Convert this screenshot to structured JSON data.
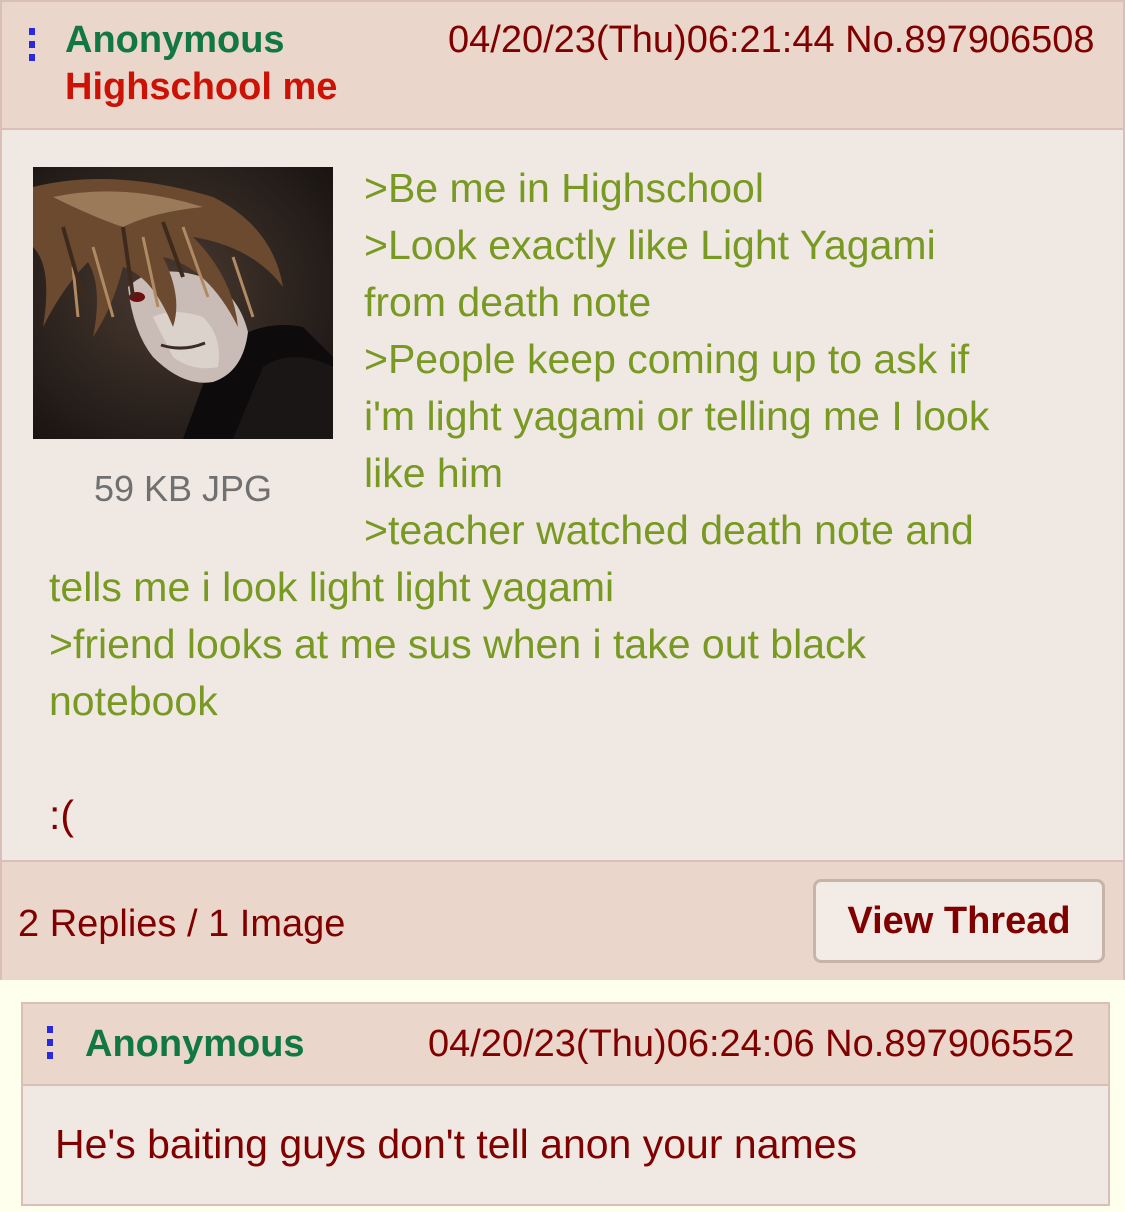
{
  "op": {
    "name": "Anonymous",
    "subject": "Highschool me",
    "datetime": "04/20/23(Thu)06:21:44 No.897906508",
    "file_info": "59 KB JPG",
    "comment": {
      "line1": ">Be me in Highschool",
      "line2": ">Look exactly like Light Yagami",
      "line3": "from death note",
      "line4": ">People keep coming up to ask if",
      "line5": "i'm light yagami or telling me I look",
      "line6": "like him",
      "line7": ">teacher watched death note and",
      "line8": "tells me i look light light yagami",
      "line9": ">friend looks at me sus when i take out black",
      "line10": "notebook",
      "line11": ":("
    },
    "replies_summary": "2 Replies / 1 Image",
    "view_thread_label": "View Thread"
  },
  "reply": {
    "name": "Anonymous",
    "datetime": "04/20/23(Thu)06:24:06 No.897906552",
    "comment": "He's baiting guys don't tell anon your names"
  },
  "colors": {
    "name": "#117743",
    "subject": "#cc1105",
    "greentext": "#789922",
    "text": "#800000",
    "post_bg": "#f0e0d6",
    "page_bg": "#ffffee"
  },
  "icons": {
    "post_menu": "vertical-dots-icon",
    "thumbnail": "anime-character-thumbnail"
  }
}
